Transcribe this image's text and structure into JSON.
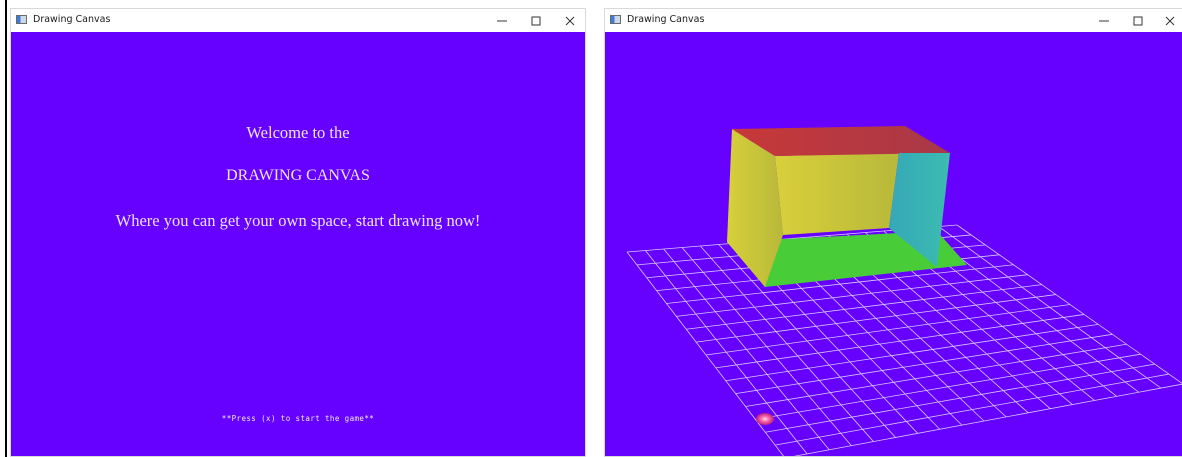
{
  "windows": {
    "left": {
      "title": "Drawing Canvas",
      "canvas_color": "#6600ff",
      "welcome": {
        "line1": "Welcome to the",
        "line2": "DRAWING CANVAS",
        "line3": "Where you can get your own space, start drawing now!"
      },
      "hint": "**Press (x) to start the game**"
    },
    "right": {
      "title": "Drawing Canvas",
      "canvas_color": "#6600ff",
      "scene": {
        "box_faces": {
          "top": "#c83a3a",
          "front": "#d2c53a",
          "side": "#3db0b8",
          "bottom": "#45cc3a"
        },
        "grid_color": "#d8c8ff",
        "marker_color": "#e8398a"
      }
    }
  },
  "icons": {
    "app": "app-window-icon",
    "minimize": "minimize-icon",
    "maximize": "maximize-icon",
    "close": "close-icon"
  }
}
